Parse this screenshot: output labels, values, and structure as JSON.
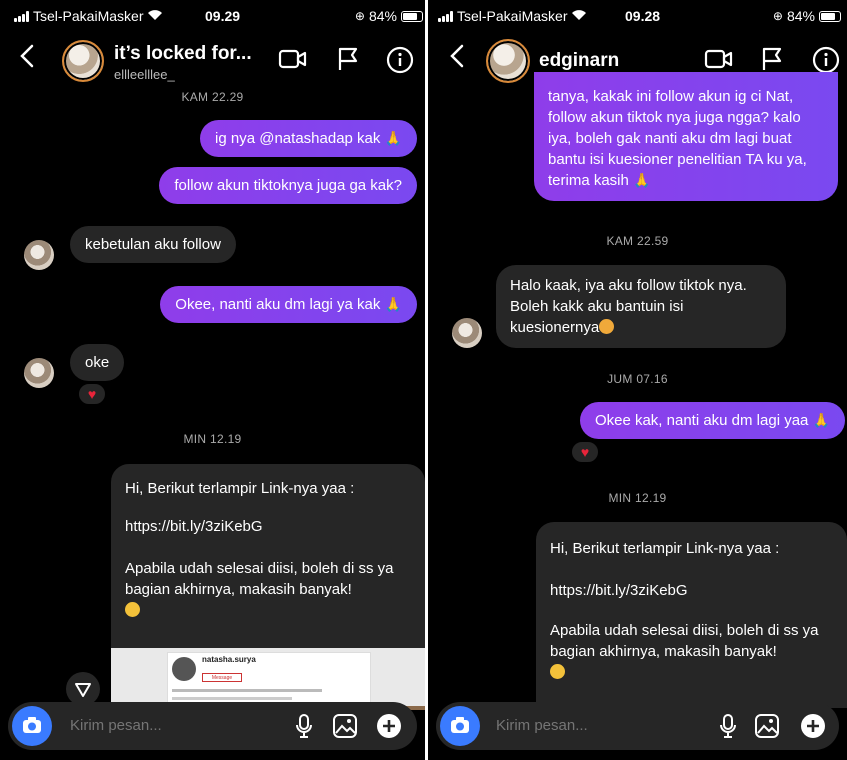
{
  "left": {
    "status": {
      "carrier": "Tsel-PakaiMasker",
      "time": "09.29",
      "battery": "84%"
    },
    "header": {
      "title": "it’s locked for...",
      "subtitle": "ellleelllee_"
    },
    "messages": {
      "stamp1": "KAM 22.29",
      "m1": "ig nya @natashadap kak",
      "m2": "follow akun tiktoknya juga ga kak?",
      "m3": "kebetulan aku follow",
      "m4": "Okee, nanti aku dm lagi ya kak",
      "m5": "oke",
      "stamp2": "MIN 12.19",
      "card_line1": "Hi, Berikut terlampir Link-nya yaa :",
      "card_link": "https://bit.ly/3ziKebG",
      "card_line2": "Apabila udah selesai diisi, boleh di ss ya bagian akhirnya, makasih banyak!",
      "preview_name": "natasha.surya",
      "preview_button": "Message"
    },
    "composer": {
      "placeholder": "Kirim pesan..."
    }
  },
  "right": {
    "status": {
      "carrier": "Tsel-PakaiMasker",
      "time": "09.28",
      "battery": "84%"
    },
    "header": {
      "title": "edginarn"
    },
    "messages": {
      "m0": "tanya, kakak ini follow akun ig ci Nat, follow akun tiktok nya juga ngga? kalo iya, boleh gak nanti aku dm lagi buat bantu isi kuesioner penelitian TA ku ya, terima kasih",
      "stamp1": "KAM 22.59",
      "m1": "Halo kaak, iya aku follow tiktok nya. Boleh kakk aku bantuin isi kuesionernya",
      "stamp2": "JUM 07.16",
      "m2": "Okee kak, nanti aku dm lagi yaa",
      "stamp3": "MIN 12.19",
      "card_line1": "Hi, Berikut terlampir Link-nya yaa :",
      "card_link": "https://bit.ly/3ziKebG",
      "card_line2": "Apabila udah selesai diisi, boleh di ss ya bagian akhirnya, makasih banyak!"
    },
    "composer": {
      "placeholder": "Kirim pesan..."
    }
  },
  "colors": {
    "accent_purple": "#8a40ec",
    "camera_blue": "#3a7bff",
    "bubble_grey": "#262626"
  }
}
